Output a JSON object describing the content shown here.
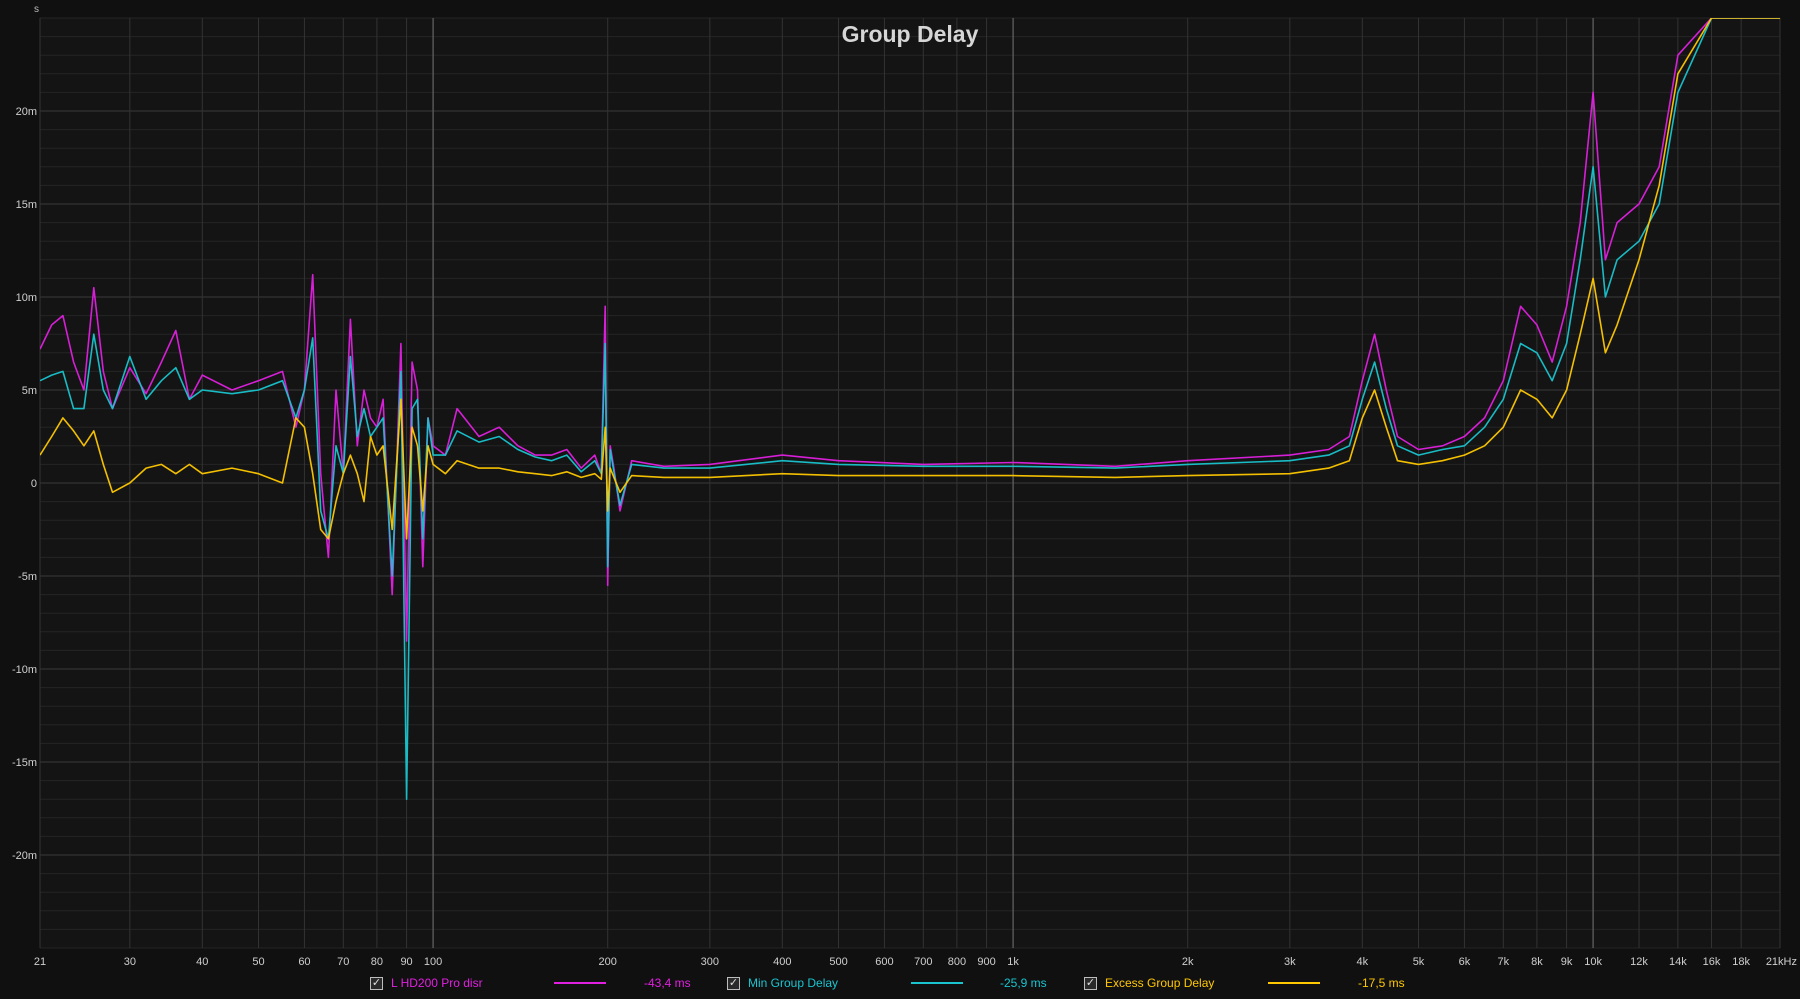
{
  "chart_data": {
    "type": "line",
    "title": "Group Delay",
    "y_unit_label": "s",
    "x_scale": "log",
    "xlim": [
      21,
      21000
    ],
    "ylim": [
      -0.025,
      0.025
    ],
    "x_tick_labels": [
      "21",
      "30",
      "40",
      "50",
      "60",
      "70",
      "80",
      "90",
      "100",
      "200",
      "300",
      "400",
      "500",
      "600",
      "700",
      "800",
      "900",
      "1k",
      "2k",
      "3k",
      "4k",
      "5k",
      "6k",
      "7k",
      "8k",
      "9k",
      "10k",
      "12k",
      "14k",
      "16k",
      "18k",
      "21kHz"
    ],
    "y_tick_labels": [
      "20m",
      "15m",
      "10m",
      "5m",
      "0",
      "-5m",
      "-10m",
      "-15m",
      "-20m"
    ],
    "y_tick_values": [
      0.02,
      0.015,
      0.01,
      0.005,
      0,
      -0.005,
      -0.01,
      -0.015,
      -0.02
    ],
    "grid": true,
    "series": [
      {
        "name": "L HD200 Pro disr",
        "color": "#e020e0",
        "readout": "-43,4 ms",
        "checked": true,
        "x": [
          21,
          22,
          23,
          24,
          25,
          26,
          27,
          28,
          30,
          32,
          34,
          36,
          38,
          40,
          45,
          50,
          55,
          58,
          60,
          62,
          64,
          66,
          68,
          70,
          72,
          74,
          76,
          78,
          80,
          82,
          85,
          88,
          90,
          92,
          94,
          96,
          98,
          100,
          105,
          110,
          120,
          130,
          140,
          150,
          160,
          170,
          180,
          190,
          195,
          198,
          200,
          202,
          205,
          210,
          220,
          250,
          300,
          400,
          500,
          700,
          1000,
          1500,
          2000,
          3000,
          3500,
          3800,
          4000,
          4200,
          4400,
          4600,
          5000,
          5500,
          6000,
          6500,
          7000,
          7500,
          8000,
          8500,
          9000,
          9500,
          10000,
          10500,
          11000,
          12000,
          13000,
          14000,
          16000,
          18000,
          21000
        ],
        "y": [
          0.0072,
          0.0085,
          0.009,
          0.0065,
          0.005,
          0.0105,
          0.006,
          0.004,
          0.0062,
          0.0048,
          0.0065,
          0.0082,
          0.0045,
          0.0058,
          0.005,
          0.0055,
          0.006,
          0.003,
          0.005,
          0.0112,
          0.0005,
          -0.004,
          0.005,
          0.0005,
          0.0088,
          0.002,
          0.005,
          0.0035,
          0.003,
          0.0045,
          -0.006,
          0.0075,
          -0.0085,
          0.0065,
          0.005,
          -0.0045,
          0.0035,
          0.002,
          0.0015,
          0.004,
          0.0025,
          0.003,
          0.002,
          0.0015,
          0.0015,
          0.0018,
          0.0008,
          0.0015,
          0.0005,
          0.0095,
          -0.0055,
          0.002,
          0.0008,
          -0.0015,
          0.0012,
          0.0009,
          0.001,
          0.0015,
          0.0012,
          0.001,
          0.0011,
          0.0009,
          0.0012,
          0.0015,
          0.0018,
          0.0025,
          0.0055,
          0.008,
          0.005,
          0.0025,
          0.0018,
          0.002,
          0.0025,
          0.0035,
          0.0055,
          0.0095,
          0.0085,
          0.0065,
          0.0095,
          0.014,
          0.021,
          0.012,
          0.014,
          0.015,
          0.017,
          0.023,
          0.025,
          0.025,
          0.025
        ]
      },
      {
        "name": "Min Group Delay",
        "color": "#19c4cf",
        "readout": "-25,9 ms",
        "checked": true,
        "x": [
          21,
          22,
          23,
          24,
          25,
          26,
          27,
          28,
          30,
          32,
          34,
          36,
          38,
          40,
          45,
          50,
          55,
          58,
          60,
          62,
          64,
          66,
          68,
          70,
          72,
          74,
          76,
          78,
          80,
          82,
          85,
          88,
          90,
          92,
          94,
          96,
          98,
          100,
          105,
          110,
          120,
          130,
          140,
          150,
          160,
          170,
          180,
          190,
          195,
          198,
          200,
          202,
          205,
          210,
          220,
          250,
          300,
          400,
          500,
          700,
          1000,
          1500,
          2000,
          3000,
          3500,
          3800,
          4000,
          4200,
          4400,
          4600,
          5000,
          5500,
          6000,
          6500,
          7000,
          7500,
          8000,
          8500,
          9000,
          9500,
          10000,
          10500,
          11000,
          12000,
          13000,
          14000,
          16000,
          18000,
          21000
        ],
        "y": [
          0.0055,
          0.0058,
          0.006,
          0.004,
          0.004,
          0.008,
          0.005,
          0.004,
          0.0068,
          0.0045,
          0.0055,
          0.0062,
          0.0045,
          0.005,
          0.0048,
          0.005,
          0.0055,
          0.0035,
          0.005,
          0.0078,
          -0.0015,
          -0.003,
          0.002,
          0.0005,
          0.0068,
          0.0025,
          0.004,
          0.0025,
          0.003,
          0.0035,
          -0.005,
          0.006,
          -0.017,
          0.004,
          0.0045,
          -0.003,
          0.0035,
          0.0015,
          0.0015,
          0.0028,
          0.0022,
          0.0025,
          0.0018,
          0.0014,
          0.0012,
          0.0015,
          0.0006,
          0.0012,
          0.0005,
          0.0075,
          -0.0045,
          0.0018,
          0.0006,
          -0.0012,
          0.001,
          0.0008,
          0.0008,
          0.0012,
          0.001,
          0.0009,
          0.0009,
          0.0008,
          0.001,
          0.0012,
          0.0015,
          0.002,
          0.0045,
          0.0065,
          0.004,
          0.002,
          0.0015,
          0.0018,
          0.002,
          0.003,
          0.0045,
          0.0075,
          0.007,
          0.0055,
          0.0075,
          0.012,
          0.017,
          0.01,
          0.012,
          0.013,
          0.015,
          0.021,
          0.025,
          0.025,
          0.025
        ]
      },
      {
        "name": "Excess Group Delay",
        "color": "#ffc800",
        "readout": "-17,5 ms",
        "checked": true,
        "x": [
          21,
          22,
          23,
          24,
          25,
          26,
          27,
          28,
          30,
          32,
          34,
          36,
          38,
          40,
          45,
          50,
          55,
          58,
          60,
          62,
          64,
          66,
          68,
          70,
          72,
          74,
          76,
          78,
          80,
          82,
          85,
          88,
          90,
          92,
          94,
          96,
          98,
          100,
          105,
          110,
          120,
          130,
          140,
          150,
          160,
          170,
          180,
          190,
          195,
          198,
          200,
          202,
          205,
          210,
          220,
          250,
          300,
          400,
          500,
          700,
          1000,
          1500,
          2000,
          3000,
          3500,
          3800,
          4000,
          4200,
          4400,
          4600,
          5000,
          5500,
          6000,
          6500,
          7000,
          7500,
          8000,
          8500,
          9000,
          9500,
          10000,
          10500,
          11000,
          12000,
          13000,
          14000,
          16000,
          18000,
          21000
        ],
        "y": [
          0.0015,
          0.0025,
          0.0035,
          0.0028,
          0.002,
          0.0028,
          0.001,
          -0.0005,
          0,
          0.0008,
          0.001,
          0.0005,
          0.001,
          0.0005,
          0.0008,
          0.0005,
          0,
          0.0035,
          0.003,
          0.0005,
          -0.0025,
          -0.003,
          -0.001,
          0.0005,
          0.0015,
          0.0005,
          -0.001,
          0.0025,
          0.0015,
          0.002,
          -0.0025,
          0.0045,
          -0.003,
          0.003,
          0.002,
          -0.0015,
          0.002,
          0.001,
          0.0005,
          0.0012,
          0.0008,
          0.0008,
          0.0006,
          0.0005,
          0.0004,
          0.0006,
          0.0003,
          0.0005,
          0.0002,
          0.003,
          -0.0015,
          0.0008,
          0.0003,
          -0.0005,
          0.0004,
          0.0003,
          0.0003,
          0.0005,
          0.0004,
          0.0004,
          0.0004,
          0.0003,
          0.0004,
          0.0005,
          0.0008,
          0.0012,
          0.0035,
          0.005,
          0.003,
          0.0012,
          0.001,
          0.0012,
          0.0015,
          0.002,
          0.003,
          0.005,
          0.0045,
          0.0035,
          0.005,
          0.008,
          0.011,
          0.007,
          0.0085,
          0.012,
          0.016,
          0.022,
          0.025,
          0.025,
          0.025
        ]
      }
    ]
  },
  "icons": {
    "checkbox": "check-icon"
  }
}
